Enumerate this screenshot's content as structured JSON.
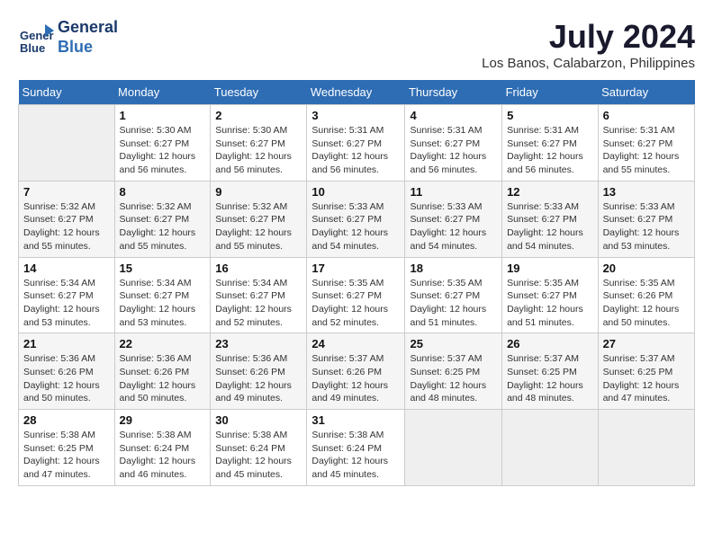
{
  "header": {
    "logo_line1": "General",
    "logo_line2": "Blue",
    "month_year": "July 2024",
    "location": "Los Banos, Calabarzon, Philippines"
  },
  "days_of_week": [
    "Sunday",
    "Monday",
    "Tuesday",
    "Wednesday",
    "Thursday",
    "Friday",
    "Saturday"
  ],
  "weeks": [
    [
      {
        "day": "",
        "info": ""
      },
      {
        "day": "1",
        "info": "Sunrise: 5:30 AM\nSunset: 6:27 PM\nDaylight: 12 hours\nand 56 minutes."
      },
      {
        "day": "2",
        "info": "Sunrise: 5:30 AM\nSunset: 6:27 PM\nDaylight: 12 hours\nand 56 minutes."
      },
      {
        "day": "3",
        "info": "Sunrise: 5:31 AM\nSunset: 6:27 PM\nDaylight: 12 hours\nand 56 minutes."
      },
      {
        "day": "4",
        "info": "Sunrise: 5:31 AM\nSunset: 6:27 PM\nDaylight: 12 hours\nand 56 minutes."
      },
      {
        "day": "5",
        "info": "Sunrise: 5:31 AM\nSunset: 6:27 PM\nDaylight: 12 hours\nand 56 minutes."
      },
      {
        "day": "6",
        "info": "Sunrise: 5:31 AM\nSunset: 6:27 PM\nDaylight: 12 hours\nand 55 minutes."
      }
    ],
    [
      {
        "day": "7",
        "info": "Sunrise: 5:32 AM\nSunset: 6:27 PM\nDaylight: 12 hours\nand 55 minutes."
      },
      {
        "day": "8",
        "info": "Sunrise: 5:32 AM\nSunset: 6:27 PM\nDaylight: 12 hours\nand 55 minutes."
      },
      {
        "day": "9",
        "info": "Sunrise: 5:32 AM\nSunset: 6:27 PM\nDaylight: 12 hours\nand 55 minutes."
      },
      {
        "day": "10",
        "info": "Sunrise: 5:33 AM\nSunset: 6:27 PM\nDaylight: 12 hours\nand 54 minutes."
      },
      {
        "day": "11",
        "info": "Sunrise: 5:33 AM\nSunset: 6:27 PM\nDaylight: 12 hours\nand 54 minutes."
      },
      {
        "day": "12",
        "info": "Sunrise: 5:33 AM\nSunset: 6:27 PM\nDaylight: 12 hours\nand 54 minutes."
      },
      {
        "day": "13",
        "info": "Sunrise: 5:33 AM\nSunset: 6:27 PM\nDaylight: 12 hours\nand 53 minutes."
      }
    ],
    [
      {
        "day": "14",
        "info": "Sunrise: 5:34 AM\nSunset: 6:27 PM\nDaylight: 12 hours\nand 53 minutes."
      },
      {
        "day": "15",
        "info": "Sunrise: 5:34 AM\nSunset: 6:27 PM\nDaylight: 12 hours\nand 53 minutes."
      },
      {
        "day": "16",
        "info": "Sunrise: 5:34 AM\nSunset: 6:27 PM\nDaylight: 12 hours\nand 52 minutes."
      },
      {
        "day": "17",
        "info": "Sunrise: 5:35 AM\nSunset: 6:27 PM\nDaylight: 12 hours\nand 52 minutes."
      },
      {
        "day": "18",
        "info": "Sunrise: 5:35 AM\nSunset: 6:27 PM\nDaylight: 12 hours\nand 51 minutes."
      },
      {
        "day": "19",
        "info": "Sunrise: 5:35 AM\nSunset: 6:27 PM\nDaylight: 12 hours\nand 51 minutes."
      },
      {
        "day": "20",
        "info": "Sunrise: 5:35 AM\nSunset: 6:26 PM\nDaylight: 12 hours\nand 50 minutes."
      }
    ],
    [
      {
        "day": "21",
        "info": "Sunrise: 5:36 AM\nSunset: 6:26 PM\nDaylight: 12 hours\nand 50 minutes."
      },
      {
        "day": "22",
        "info": "Sunrise: 5:36 AM\nSunset: 6:26 PM\nDaylight: 12 hours\nand 50 minutes."
      },
      {
        "day": "23",
        "info": "Sunrise: 5:36 AM\nSunset: 6:26 PM\nDaylight: 12 hours\nand 49 minutes."
      },
      {
        "day": "24",
        "info": "Sunrise: 5:37 AM\nSunset: 6:26 PM\nDaylight: 12 hours\nand 49 minutes."
      },
      {
        "day": "25",
        "info": "Sunrise: 5:37 AM\nSunset: 6:25 PM\nDaylight: 12 hours\nand 48 minutes."
      },
      {
        "day": "26",
        "info": "Sunrise: 5:37 AM\nSunset: 6:25 PM\nDaylight: 12 hours\nand 48 minutes."
      },
      {
        "day": "27",
        "info": "Sunrise: 5:37 AM\nSunset: 6:25 PM\nDaylight: 12 hours\nand 47 minutes."
      }
    ],
    [
      {
        "day": "28",
        "info": "Sunrise: 5:38 AM\nSunset: 6:25 PM\nDaylight: 12 hours\nand 47 minutes."
      },
      {
        "day": "29",
        "info": "Sunrise: 5:38 AM\nSunset: 6:24 PM\nDaylight: 12 hours\nand 46 minutes."
      },
      {
        "day": "30",
        "info": "Sunrise: 5:38 AM\nSunset: 6:24 PM\nDaylight: 12 hours\nand 45 minutes."
      },
      {
        "day": "31",
        "info": "Sunrise: 5:38 AM\nSunset: 6:24 PM\nDaylight: 12 hours\nand 45 minutes."
      },
      {
        "day": "",
        "info": ""
      },
      {
        "day": "",
        "info": ""
      },
      {
        "day": "",
        "info": ""
      }
    ]
  ]
}
